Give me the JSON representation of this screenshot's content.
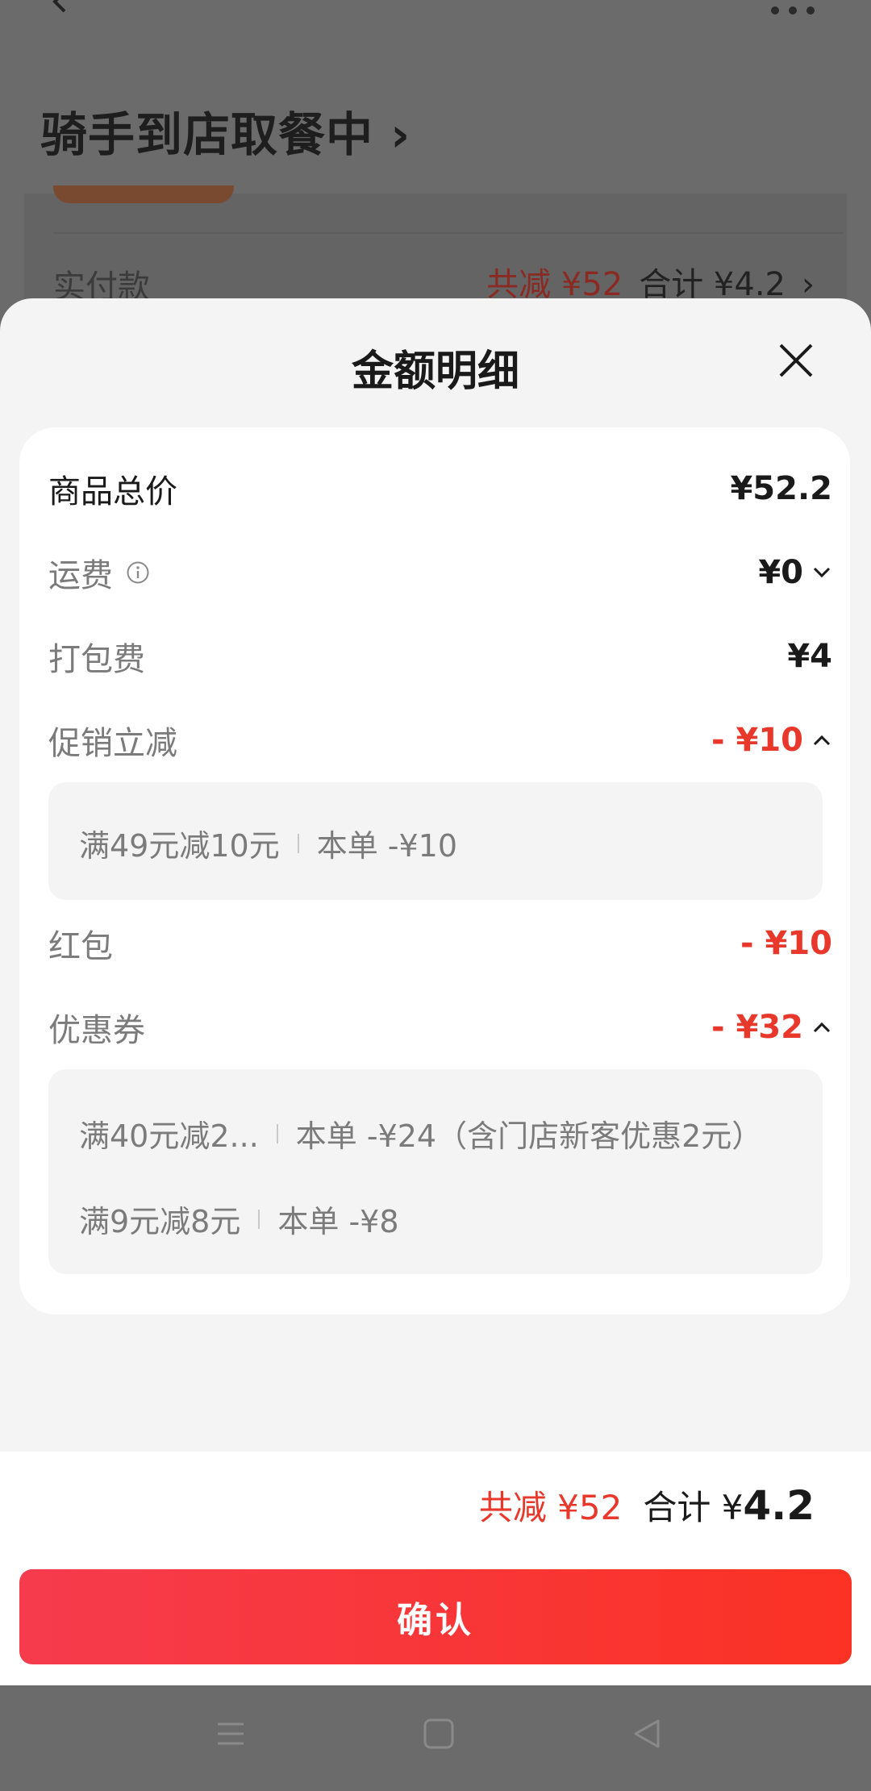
{
  "background_page": {
    "order_status": "骑手到店取餐中",
    "paid_label": "实付款",
    "paid_discount": "共减 ¥52",
    "paid_total": "合计 ¥4.2"
  },
  "sheet": {
    "title": "金额明细",
    "rows": {
      "goods_total": {
        "label": "商品总价",
        "value": "¥52.2"
      },
      "shipping": {
        "label": "运费",
        "value": "¥0"
      },
      "packing": {
        "label": "打包费",
        "value": "¥4"
      },
      "promo": {
        "label": "促销立减",
        "value": "- ¥10"
      },
      "red_packet": {
        "label": "红包",
        "value": "- ¥10"
      },
      "coupon": {
        "label": "优惠券",
        "value": "- ¥32"
      }
    },
    "promo_details": [
      {
        "rule": "满49元减10元",
        "applied": "本单 -¥10"
      }
    ],
    "coupon_details": [
      {
        "rule": "满40元减2...",
        "applied": "本单 -¥24（含门店新客优惠2元）"
      },
      {
        "rule": "满9元减8元",
        "applied": "本单 -¥8"
      }
    ]
  },
  "summary": {
    "discount": "共减 ¥52",
    "total_prefix": "合计 ¥",
    "total_value": "4.2"
  },
  "confirm_label": "确认",
  "colors": {
    "accent_red": "#e8382c",
    "button_gradient_start": "#f63b4d",
    "button_gradient_end": "#fb3224"
  }
}
